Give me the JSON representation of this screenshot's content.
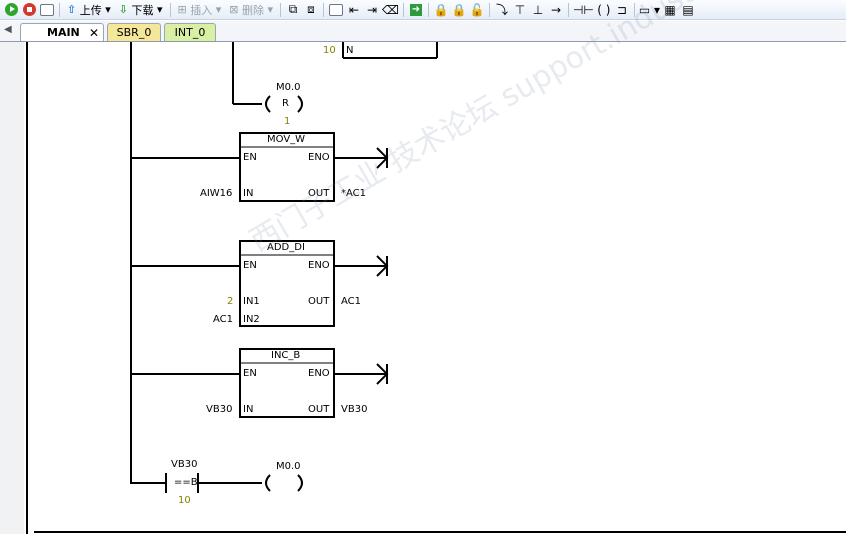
{
  "toolbar": {
    "upload_label": "上传",
    "download_label": "下载",
    "insert_label": "插入",
    "delete_label": "删除"
  },
  "tabs": [
    {
      "label": "MAIN",
      "active": true,
      "color": "#ffffff"
    },
    {
      "label": "SBR_0",
      "active": false,
      "color": "#f5e79a"
    },
    {
      "label": "INT_0",
      "active": false,
      "color": "#d9efa4"
    }
  ],
  "ladder": {
    "top_compare": {
      "value": "10",
      "pin": "N"
    },
    "reset_coil": {
      "address": "M0.0",
      "op": "R",
      "count": "1"
    },
    "mov_w": {
      "name": "MOV_W",
      "en": "EN",
      "eno": "ENO",
      "in_pin": "IN",
      "out_pin": "OUT",
      "in_val": "AIW16",
      "out_val": "*AC1"
    },
    "add_di": {
      "name": "ADD_DI",
      "en": "EN",
      "eno": "ENO",
      "in1_pin": "IN1",
      "in2_pin": "IN2",
      "out_pin": "OUT",
      "in1_val": "2",
      "in2_val": "AC1",
      "out_val": "AC1"
    },
    "inc_b": {
      "name": "INC_B",
      "en": "EN",
      "eno": "ENO",
      "in_pin": "IN",
      "out_pin": "OUT",
      "in_val": "VB30",
      "out_val": "VB30"
    },
    "compare": {
      "address": "VB30",
      "op": "==B",
      "value": "10"
    },
    "coil": {
      "address": "M0.0"
    }
  },
  "watermark": "西门子工业 技术论坛 support.industry.siemens.com/cs",
  "colors": {
    "constant": "#8a8000",
    "tab_sbr": "#f5e79a",
    "tab_int": "#d9efa4"
  }
}
